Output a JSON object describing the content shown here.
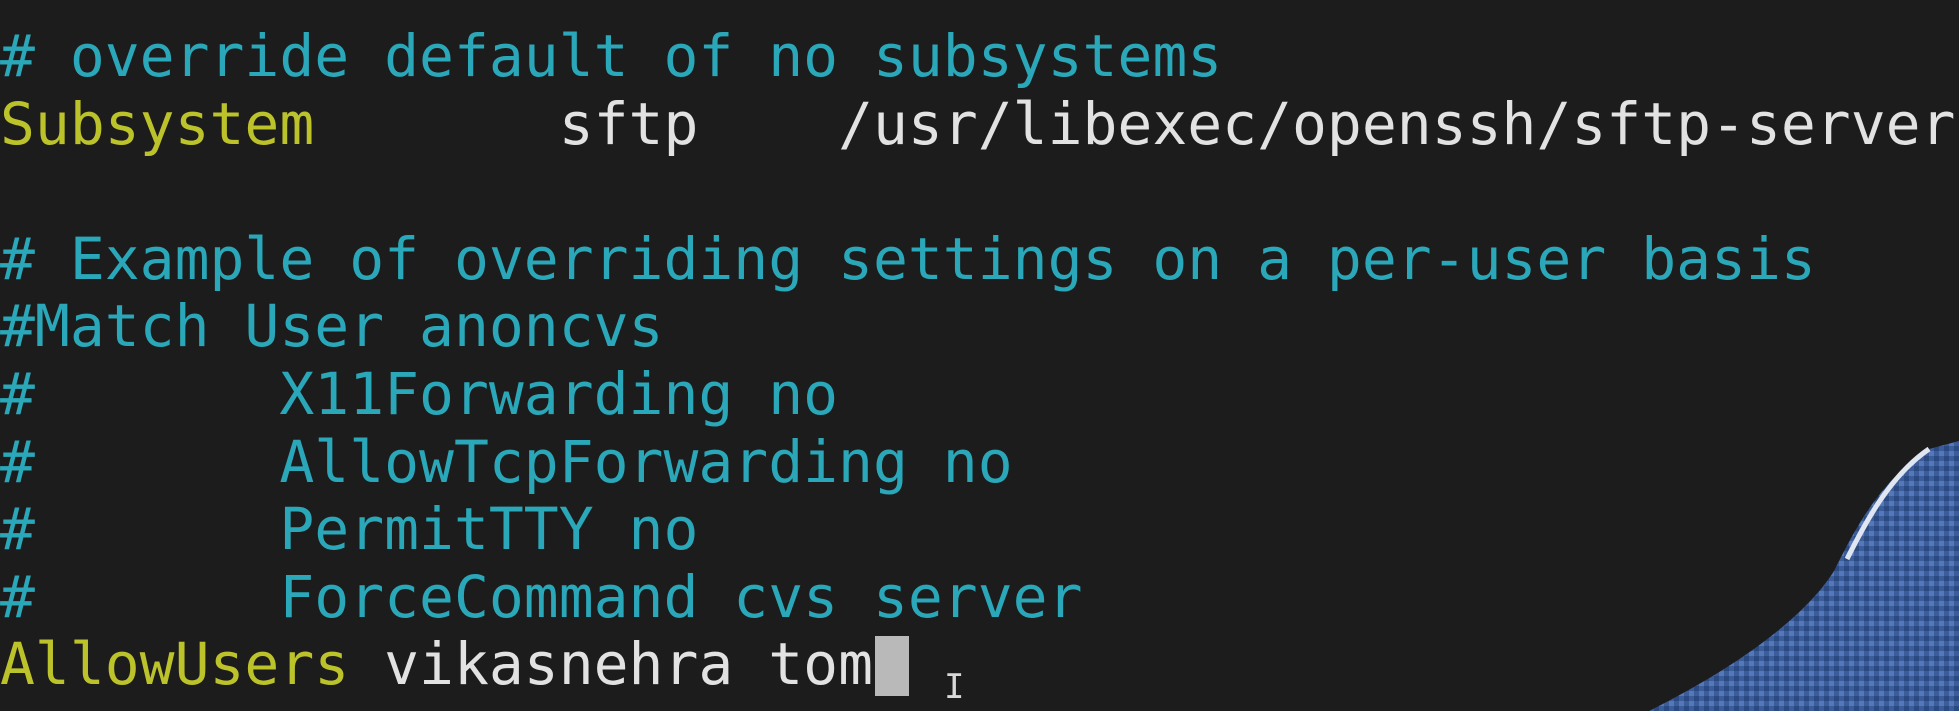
{
  "terminal": {
    "lines": [
      {
        "segments": [
          {
            "text": "# override default of no subsystems",
            "role": "comment"
          }
        ]
      },
      {
        "segments": [
          {
            "text": "Subsystem",
            "role": "keyword"
          },
          {
            "text": "       sftp    /usr/libexec/openssh/sftp-server",
            "role": "value"
          }
        ]
      },
      {
        "segments": [
          {
            "text": "",
            "role": "value"
          }
        ]
      },
      {
        "segments": [
          {
            "text": "# Example of overriding settings on a per-user basis",
            "role": "comment"
          }
        ]
      },
      {
        "segments": [
          {
            "text": "#Match User anoncvs",
            "role": "comment"
          }
        ]
      },
      {
        "segments": [
          {
            "text": "#       X11Forwarding no",
            "role": "comment"
          }
        ]
      },
      {
        "segments": [
          {
            "text": "#       AllowTcpForwarding no",
            "role": "comment"
          }
        ]
      },
      {
        "segments": [
          {
            "text": "#       PermitTTY no",
            "role": "comment"
          }
        ]
      },
      {
        "segments": [
          {
            "text": "#       ForceCommand cvs server",
            "role": "comment"
          }
        ]
      },
      {
        "segments": [
          {
            "text": "AllowUsers",
            "role": "keyword"
          },
          {
            "text": " vikasnehra tom",
            "role": "value"
          }
        ]
      }
    ],
    "cursor_line": 9
  },
  "colors": {
    "background": "#1c1c1c",
    "comment": "#2aa7b8",
    "keyword": "#bcc22a",
    "value": "#e2e2e2",
    "cursor": "#b9b9b9"
  },
  "pointer": {
    "icon": "text-ibeam-cursor-icon",
    "glyph": "I"
  }
}
